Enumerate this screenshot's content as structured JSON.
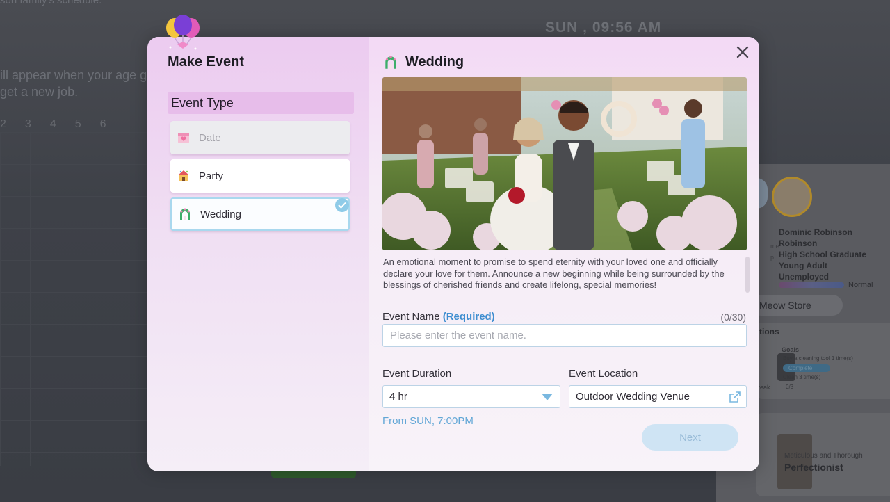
{
  "background": {
    "top_text": "son family's schedule.",
    "clock": "SUN , 09:56 AM",
    "line1": "ill appear when your age g",
    "line2": "get a new job.",
    "numbers": [
      "2",
      "3",
      "4",
      "5",
      "6"
    ],
    "side_panel": {
      "labels": [
        "me",
        "",
        "p"
      ],
      "name": "Dominic Robinson",
      "surname": "Robinson",
      "education": "High School Graduate",
      "age": "Young Adult",
      "job": "Unemployed",
      "mood": "Normal",
      "store_button": "Meow Store",
      "card1_title": "tions",
      "card1_goals_title": "Goals",
      "card1_goal1": "Buy a cleaning tool 1 time(s)",
      "card1_complete": "Complete",
      "card1_goal2": "Clean 3 time(s)",
      "card1_progress": "0/3",
      "card1_side_label": "reak",
      "card2_subtitle": "Meticulous and Thorough",
      "card2_title": "Perfectionist"
    }
  },
  "modal": {
    "title": "Make Event",
    "section_title": "Event Type",
    "event_types": [
      {
        "label": "Date",
        "icon": "calendar-heart-icon",
        "state": "disabled"
      },
      {
        "label": "Party",
        "icon": "party-house-icon",
        "state": "normal"
      },
      {
        "label": "Wedding",
        "icon": "wedding-arch-icon",
        "state": "selected"
      }
    ],
    "close_icon": "close-icon",
    "selected_event": {
      "title": "Wedding",
      "image": "wedding-ceremony-photo",
      "description": "An emotional moment to promise to spend eternity with your loved one and officially declare your love for them. Announce a new beginning while being surrounded by the blessings of cherished friends and create lifelong, special memories!"
    },
    "form": {
      "name_label": "Event Name",
      "name_required": "(Required)",
      "name_counter": "(0/30)",
      "name_placeholder": "Please enter the event name.",
      "name_value": "",
      "duration_label": "Event Duration",
      "duration_value": "4 hr",
      "location_label": "Event Location",
      "location_value": "Outdoor Wedding Venue",
      "start_time": "From SUN, 7:00PM",
      "next_button": "Next"
    }
  },
  "colors": {
    "accent": "#3f8ed0",
    "section_bg": "#e7bdea",
    "selected_border": "#a9d8ee",
    "next_disabled": "#cfe4f4"
  }
}
